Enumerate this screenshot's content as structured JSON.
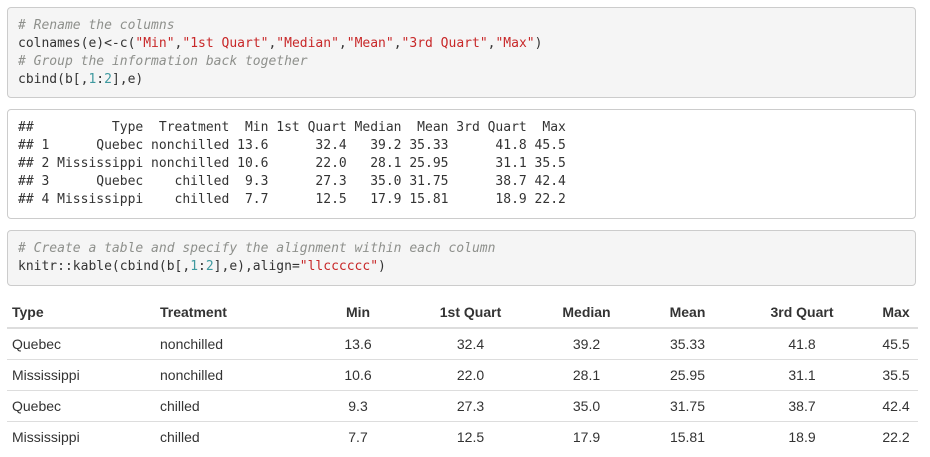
{
  "code1": {
    "lines": [
      [
        {
          "t": "cm",
          "v": "# Rename the columns"
        }
      ],
      [
        {
          "t": "",
          "v": "colnames(e)<-c("
        },
        {
          "t": "st",
          "v": "\"Min\""
        },
        {
          "t": "",
          "v": ","
        },
        {
          "t": "st",
          "v": "\"1st Quart\""
        },
        {
          "t": "",
          "v": ","
        },
        {
          "t": "st",
          "v": "\"Median\""
        },
        {
          "t": "",
          "v": ","
        },
        {
          "t": "st",
          "v": "\"Mean\""
        },
        {
          "t": "",
          "v": ","
        },
        {
          "t": "st",
          "v": "\"3rd Quart\""
        },
        {
          "t": "",
          "v": ","
        },
        {
          "t": "st",
          "v": "\"Max\""
        },
        {
          "t": "",
          "v": ")"
        }
      ],
      [
        {
          "t": "cm",
          "v": "# Group the information back together"
        }
      ],
      [
        {
          "t": "",
          "v": "cbind(b[,"
        },
        {
          "t": "nm",
          "v": "1"
        },
        {
          "t": "",
          "v": ":"
        },
        {
          "t": "nm",
          "v": "2"
        },
        {
          "t": "",
          "v": "],e)"
        }
      ]
    ]
  },
  "output1": {
    "lines": [
      "##          Type  Treatment  Min 1st Quart Median  Mean 3rd Quart  Max",
      "## 1      Quebec nonchilled 13.6      32.4   39.2 35.33      41.8 45.5",
      "## 2 Mississippi nonchilled 10.6      22.0   28.1 25.95      31.1 35.5",
      "## 3      Quebec    chilled  9.3      27.3   35.0 31.75      38.7 42.4",
      "## 4 Mississippi    chilled  7.7      12.5   17.9 15.81      18.9 22.2"
    ]
  },
  "code2": {
    "lines": [
      [
        {
          "t": "cm",
          "v": "# Create a table and specify the alignment within each column"
        }
      ],
      [
        {
          "t": "",
          "v": "knitr::kable(cbind(b[,"
        },
        {
          "t": "nm",
          "v": "1"
        },
        {
          "t": "",
          "v": ":"
        },
        {
          "t": "nm",
          "v": "2"
        },
        {
          "t": "",
          "v": "],e),align="
        },
        {
          "t": "st",
          "v": "\"llcccccc\""
        },
        {
          "t": "",
          "v": ")"
        }
      ]
    ]
  },
  "table": {
    "headers": [
      "Type",
      "Treatment",
      "Min",
      "1st Quart",
      "Median",
      "Mean",
      "3rd Quart",
      "Max"
    ],
    "rows": [
      [
        "Quebec",
        "nonchilled",
        "13.6",
        "32.4",
        "39.2",
        "35.33",
        "41.8",
        "45.5"
      ],
      [
        "Mississippi",
        "nonchilled",
        "10.6",
        "22.0",
        "28.1",
        "25.95",
        "31.1",
        "35.5"
      ],
      [
        "Quebec",
        "chilled",
        "9.3",
        "27.3",
        "35.0",
        "31.75",
        "38.7",
        "42.4"
      ],
      [
        "Mississippi",
        "chilled",
        "7.7",
        "12.5",
        "17.9",
        "15.81",
        "18.9",
        "22.2"
      ]
    ]
  }
}
